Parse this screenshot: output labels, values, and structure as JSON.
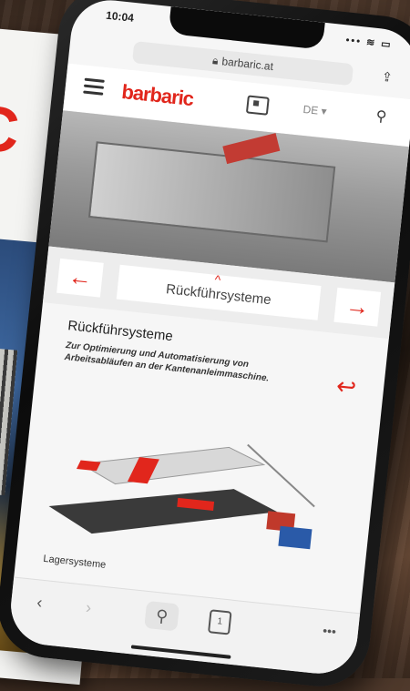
{
  "status": {
    "time": "10:04",
    "signal": "•••  ≋  ▭"
  },
  "browser": {
    "url": "barbaric.at"
  },
  "header": {
    "brand": "barbaric",
    "lang": "DE"
  },
  "carousel": {
    "title": "Rückführsysteme"
  },
  "section": {
    "title": "Rückführsysteme",
    "description": "Zur Optimierung und Automatisierung von Arbeitsabläufen an der Kantenanleimmaschine."
  },
  "next_section": {
    "label": "Lagersysteme"
  },
  "colors": {
    "accent": "#e1261c"
  }
}
